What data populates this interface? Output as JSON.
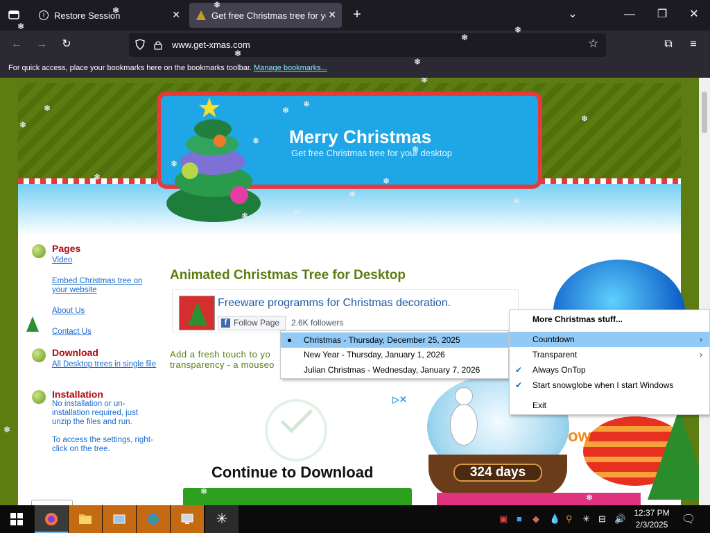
{
  "browser": {
    "tabs": [
      {
        "title": "Restore Session",
        "active": false
      },
      {
        "title": "Get free Christmas tree for your",
        "active": true
      }
    ],
    "url": "www.get-xmas.com",
    "bookmarks_hint": "For quick access, place your bookmarks here on the bookmarks toolbar.",
    "bookmarks_link": "Manage bookmarks..."
  },
  "banner": {
    "title": "Merry Christmas",
    "subtitle": "Get free Christmas tree for your desktop"
  },
  "sidebar": {
    "sections": [
      {
        "heading": "Pages",
        "links": [
          "Video",
          "Embed Christmas tree on your website",
          "About Us",
          "Contact Us"
        ]
      },
      {
        "heading": "Download",
        "links": [
          "All Desktop trees in single file"
        ]
      },
      {
        "heading": "Installation",
        "text": [
          "No installation or un-installation required, just unzip the files and run.",
          "To access the settings, right-click on the tree."
        ]
      }
    ]
  },
  "main": {
    "title": "Animated Christmas Tree for Desktop",
    "fb_title": "Freeware programms for Christmas decoration.",
    "fb_follow": "Follow Page",
    "fb_followers": "2.6K followers",
    "intro_line1": "Add a fresh touch to yo",
    "intro_line2": "transparency - a mouseo",
    "ad_title": "Continue to Download",
    "globe_days": "324 days",
    "globe_text": "ow"
  },
  "countdown_menu": {
    "items": [
      {
        "label": "Christmas - Thursday, December 25, 2025",
        "selected": true
      },
      {
        "label": "New Year - Thursday, January 1, 2026",
        "selected": false
      },
      {
        "label": "Julian Christmas - Wednesday, January 7, 2026",
        "selected": false
      }
    ]
  },
  "tree_menu": {
    "items": [
      {
        "label": "More Christmas stuff...",
        "bold": true
      },
      {
        "label": "Countdown",
        "submenu": true,
        "highlighted": true
      },
      {
        "label": "Transparent",
        "submenu": true
      },
      {
        "label": "Always OnTop",
        "checked": true
      },
      {
        "label": "Start snowglobe when I start Windows",
        "checked": true
      },
      {
        "label": "Exit"
      }
    ]
  },
  "taskbar": {
    "time": "12:37 PM",
    "date": "2/3/2025"
  },
  "colors": {
    "page_green": "#5d7d12",
    "menu_highlight": "#91c9f7",
    "link_blue": "#1a6bd0",
    "heading_red": "#b1060b"
  }
}
